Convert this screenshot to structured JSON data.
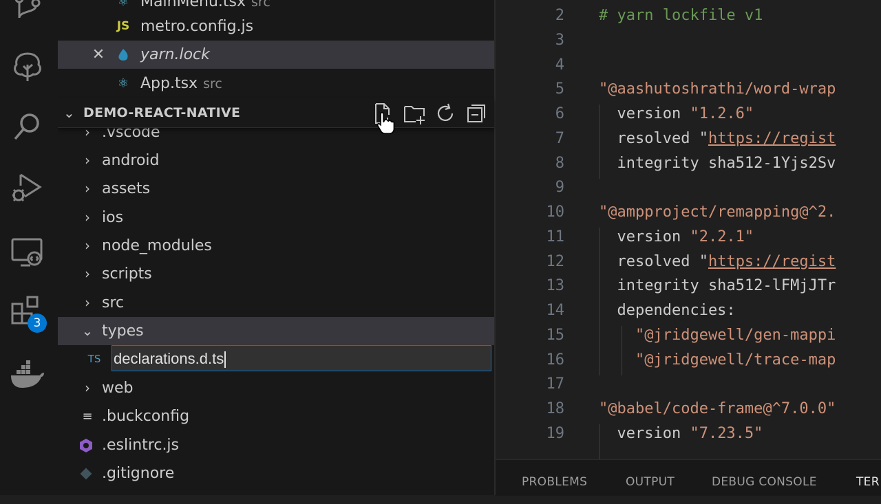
{
  "activity_bar": {
    "icons": [
      "source-control-icon",
      "tree-icon",
      "search-icon",
      "run-debug-icon",
      "remote-explorer-icon",
      "extensions-icon",
      "docker-icon"
    ],
    "extensions_badge": "3"
  },
  "explorer": {
    "open_editors": [
      {
        "name": "MainMenu.tsx",
        "desc": "src",
        "icon": "react"
      },
      {
        "name": "metro.config.js",
        "desc": "",
        "icon": "JS"
      },
      {
        "name": "yarn.lock",
        "desc": "",
        "icon": "yarn"
      },
      {
        "name": "App.tsx",
        "desc": "src",
        "icon": "react"
      }
    ],
    "section_title": "DEMO-REACT-NATIVE",
    "folders_top": [
      ".vscode",
      "android",
      "assets",
      "ios",
      "node_modules",
      "scripts",
      "src",
      "types"
    ],
    "rename_icon": "TS",
    "rename_value": "declarations.d.ts",
    "after_items": [
      {
        "name": "web",
        "kind": "folder"
      },
      {
        "name": ".buckconfig",
        "kind": "file"
      },
      {
        "name": ".eslintrc.js",
        "kind": "file"
      },
      {
        "name": ".gitignore",
        "kind": "file"
      }
    ]
  },
  "editor": {
    "lines": [
      {
        "n": "2",
        "text": "# yarn lockfile v1"
      },
      {
        "n": "3",
        "text": ""
      },
      {
        "n": "4",
        "text": ""
      },
      {
        "n": "5",
        "text": "\"@aashutoshrathi/word-wrap"
      },
      {
        "n": "6",
        "text": "  version \"1.2.6\""
      },
      {
        "n": "7",
        "text": "  resolved \"https://regist"
      },
      {
        "n": "8",
        "text": "  integrity sha512-1Yjs2Sv"
      },
      {
        "n": "9",
        "text": ""
      },
      {
        "n": "10",
        "text": "\"@ampproject/remapping@^2."
      },
      {
        "n": "11",
        "text": "  version \"2.2.1\""
      },
      {
        "n": "12",
        "text": "  resolved \"https://regist"
      },
      {
        "n": "13",
        "text": "  integrity sha512-lFMjJTr"
      },
      {
        "n": "14",
        "text": "  dependencies:"
      },
      {
        "n": "15",
        "text": "    \"@jridgewell/gen-mappi"
      },
      {
        "n": "16",
        "text": "    \"@jridgewell/trace-map"
      },
      {
        "n": "17",
        "text": ""
      },
      {
        "n": "18",
        "text": "\"@babel/code-frame@^7.0.0\""
      },
      {
        "n": "19",
        "text": "  version \"7.23.5\""
      }
    ]
  },
  "panel": {
    "tabs": [
      "PROBLEMS",
      "OUTPUT",
      "DEBUG CONSOLE",
      "TER"
    ]
  }
}
